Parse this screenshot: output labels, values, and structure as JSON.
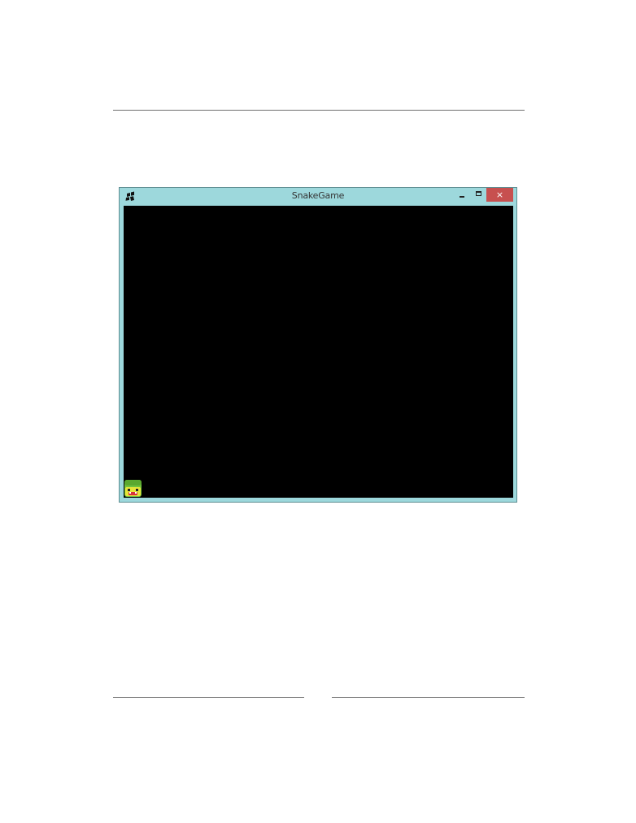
{
  "window": {
    "title": "SnakeGame",
    "controls": {
      "minimize_icon": "minimize-icon",
      "maximize_icon": "maximize-icon",
      "close_icon": "close-icon",
      "close_glyph": "×"
    },
    "app_icon": "windows-logo-icon"
  },
  "game": {
    "background": "#000000",
    "snake_head_icon": "snake-head-icon"
  },
  "colors": {
    "titlebar": "#9dd8dc",
    "close_button": "#c7504f",
    "snake_green": "#6fc23f",
    "snake_yellow": "#e6e53a",
    "snake_mouth": "#d8323a"
  }
}
